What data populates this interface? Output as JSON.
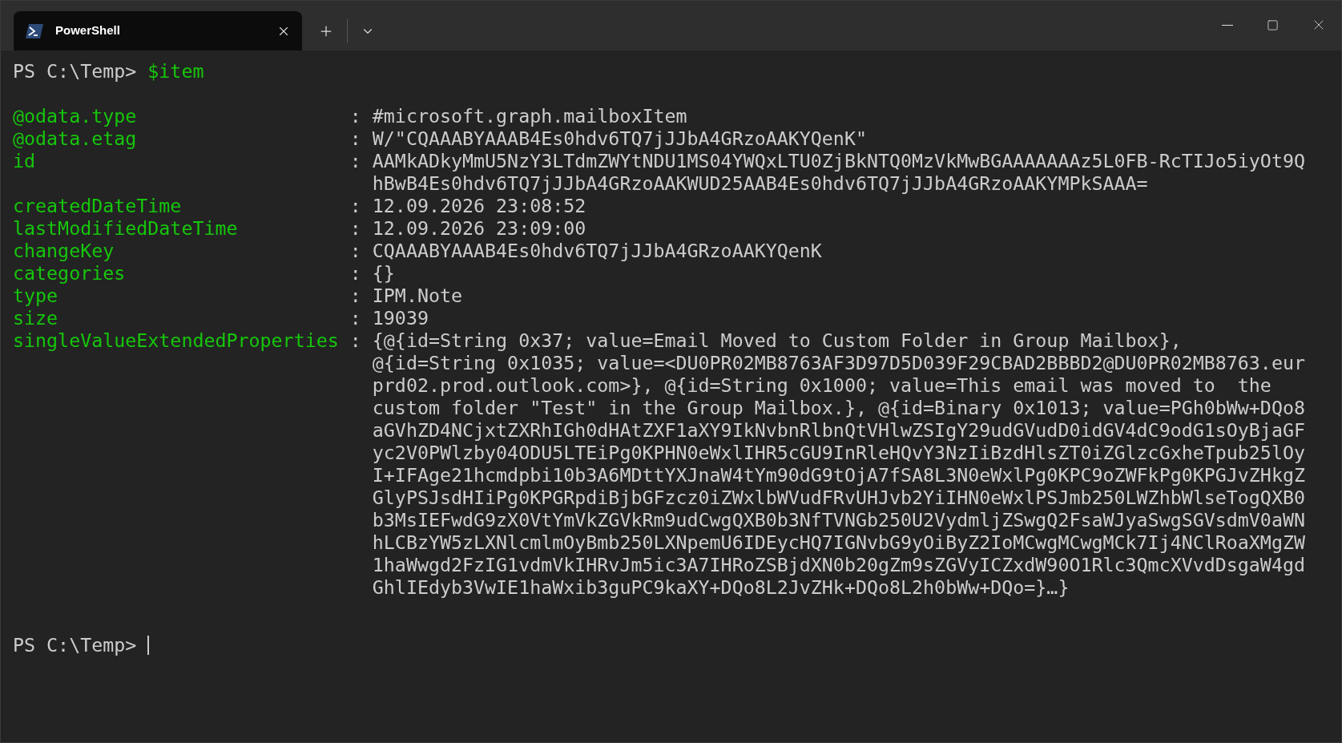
{
  "window": {
    "tabs": [
      {
        "title": "PowerShell",
        "selected": true
      }
    ]
  },
  "terminal": {
    "command_line": {
      "prompt": "PS C:\\Temp>",
      "command": "$item"
    },
    "properties": [
      {
        "name": "@odata.type",
        "separator": ":",
        "lines": [
          "#microsoft.graph.mailboxItem"
        ]
      },
      {
        "name": "@odata.etag",
        "separator": ":",
        "lines": [
          "W/\"CQAAABYAAAB4Es0hdv6TQ7jJJbA4GRzoAAKYQenK\""
        ]
      },
      {
        "name": "id",
        "separator": ":",
        "lines": [
          "AAMkADkyMmU5NzY3LTdmZWYtNDU1MS04YWQxLTU0ZjBkNTQ0MzVkMwBGAAAAAAAz5L0FB-RcTIJo5iyOt9Q",
          "hBwB4Es0hdv6TQ7jJJbA4GRzoAAKWUD25AAB4Es0hdv6TQ7jJJbA4GRzoAAKYMPkSAAA="
        ]
      },
      {
        "name": "createdDateTime",
        "separator": ":",
        "lines": [
          "12.09.2026 23:08:52"
        ]
      },
      {
        "name": "lastModifiedDateTime",
        "separator": ":",
        "lines": [
          "12.09.2026 23:09:00"
        ]
      },
      {
        "name": "changeKey",
        "separator": ":",
        "lines": [
          "CQAAABYAAAB4Es0hdv6TQ7jJJbA4GRzoAAKYQenK"
        ]
      },
      {
        "name": "categories",
        "separator": ":",
        "lines": [
          "{}"
        ]
      },
      {
        "name": "type",
        "separator": ":",
        "lines": [
          "IPM.Note"
        ]
      },
      {
        "name": "size",
        "separator": ":",
        "lines": [
          "19039"
        ]
      },
      {
        "name": "singleValueExtendedProperties",
        "separator": ":",
        "lines": [
          "{@{id=String 0x37; value=Email Moved to Custom Folder in Group Mailbox},",
          "@{id=String 0x1035; value=<DU0PR02MB8763AF3D97D5D039F29CBAD2BBBD2@DU0PR02MB8763.eur",
          "prd02.prod.outlook.com>}, @{id=String 0x1000; value=This email was moved to  the",
          "custom folder \"Test\" in the Group Mailbox.}, @{id=Binary 0x1013; value=PGh0bWw+DQo8",
          "aGVhZD4NCjxtZXRhIGh0dHAtZXF1aXY9IkNvbnRlbnQtVHlwZSIgY29udGVudD0idGV4dC9odG1sOyBjaGF",
          "yc2V0PWlzby04ODU5LTEiPg0KPHN0eWxlIHR5cGU9InRleHQvY3NzIiBzdHlsZT0iZGlzcGxheTpub25lOy",
          "I+IFAge21hcmdpbi10b3A6MDttYXJnaW4tYm90dG9tOjA7fSA8L3N0eWxlPg0KPC9oZWFkPg0KPGJvZHkgZ",
          "GlyPSJsdHIiPg0KPGRpdiBjbGFzcz0iZWxlbWVudFRvUHJvb2YiIHN0eWxlPSJmb250LWZhbWlseTogQXB0",
          "b3MsIEFwdG9zX0VtYmVkZGVkRm9udCwgQXB0b3NfTVNGb250U2VydmljZSwgQ2FsaWJyaSwgSGVsdmV0aWN",
          "hLCBzYW5zLXNlcmlmOyBmb250LXNpemU6IDEycHQ7IGNvbG9yOiByZ2IoMCwgMCwgMCk7Ij4NClRoaXMgZW",
          "1haWwgd2FzIG1vdmVkIHRvJm5ic3A7IHRoZSBjdXN0b20gZm9sZGVyICZxdW90O1Rlc3QmcXVvdDsgaW4gd",
          "GhlIEdyb3VwIE1haWxib3guPC9kaXY+DQo8L2JvZHk+DQo8L2h0bWw+DQo=}…}"
        ]
      }
    ],
    "prompt_line": {
      "prompt": "PS C:\\Temp>",
      "cursor_visible": true
    }
  }
}
